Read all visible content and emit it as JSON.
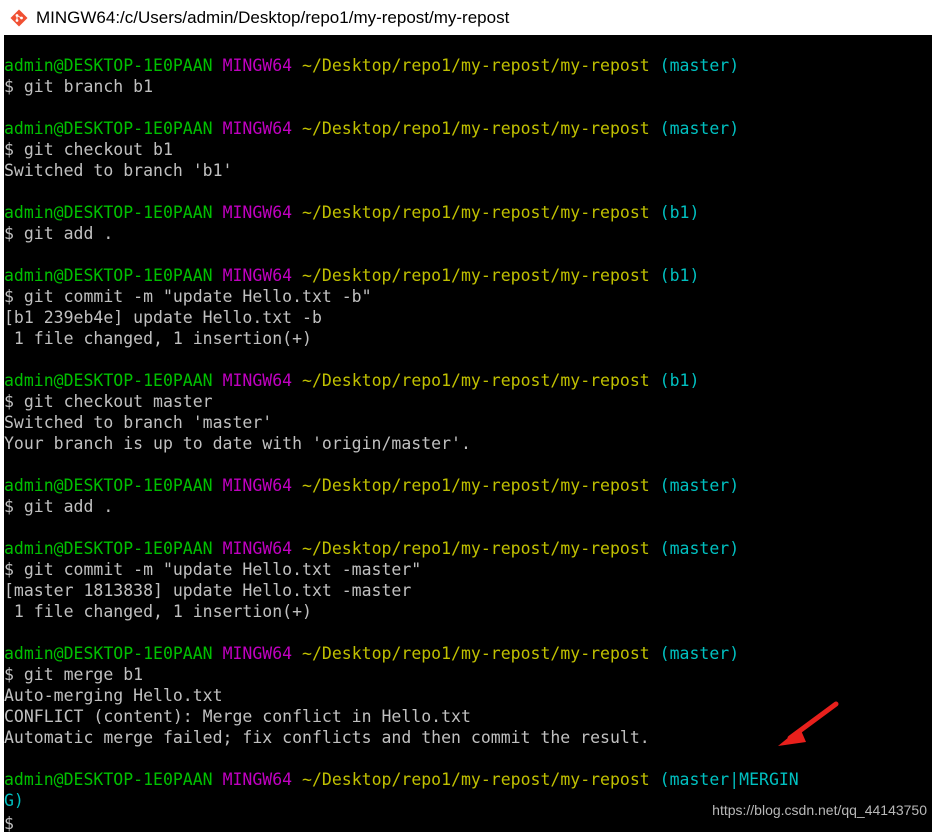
{
  "window": {
    "title": "MINGW64:/c/Users/admin/Desktop/repo1/my-repost/my-repost"
  },
  "prompt": {
    "user_host": "admin@DESKTOP-1E0PAAN",
    "shell": "MINGW64",
    "path": "~/Desktop/repo1/my-repost/my-repost"
  },
  "blocks": [
    {
      "branch": "(master)",
      "command": "$ git branch b1",
      "output": []
    },
    {
      "branch": "(master)",
      "command": "$ git checkout b1",
      "output": [
        "Switched to branch 'b1'"
      ]
    },
    {
      "branch": "(b1)",
      "command": "$ git add .",
      "output": []
    },
    {
      "branch": "(b1)",
      "command": "$ git commit -m \"update Hello.txt -b\"",
      "output": [
        "[b1 239eb4e] update Hello.txt -b",
        " 1 file changed, 1 insertion(+)"
      ]
    },
    {
      "branch": "(b1)",
      "command": "$ git checkout master",
      "output": [
        "Switched to branch 'master'",
        "Your branch is up to date with 'origin/master'."
      ]
    },
    {
      "branch": "(master)",
      "command": "$ git add .",
      "output": []
    },
    {
      "branch": "(master)",
      "command": "$ git commit -m \"update Hello.txt -master\"",
      "output": [
        "[master 1813838] update Hello.txt -master",
        " 1 file changed, 1 insertion(+)"
      ]
    },
    {
      "branch": "(master)",
      "command": "$ git merge b1",
      "output": [
        "Auto-merging Hello.txt",
        "CONFLICT (content): Merge conflict in Hello.txt",
        "Automatic merge failed; fix conflicts and then commit the result."
      ]
    }
  ],
  "final_prompt": {
    "branch": "(master|MERGIN",
    "wrap": "G)",
    "cursor": "$"
  },
  "watermark": "https://blog.csdn.net/qq_44143750",
  "colors": {
    "user": "#00c000",
    "host": "#c000c0",
    "path": "#c0c000",
    "branch": "#00c0c0",
    "text": "#c0c0c0",
    "arrow": "#e8201c"
  }
}
